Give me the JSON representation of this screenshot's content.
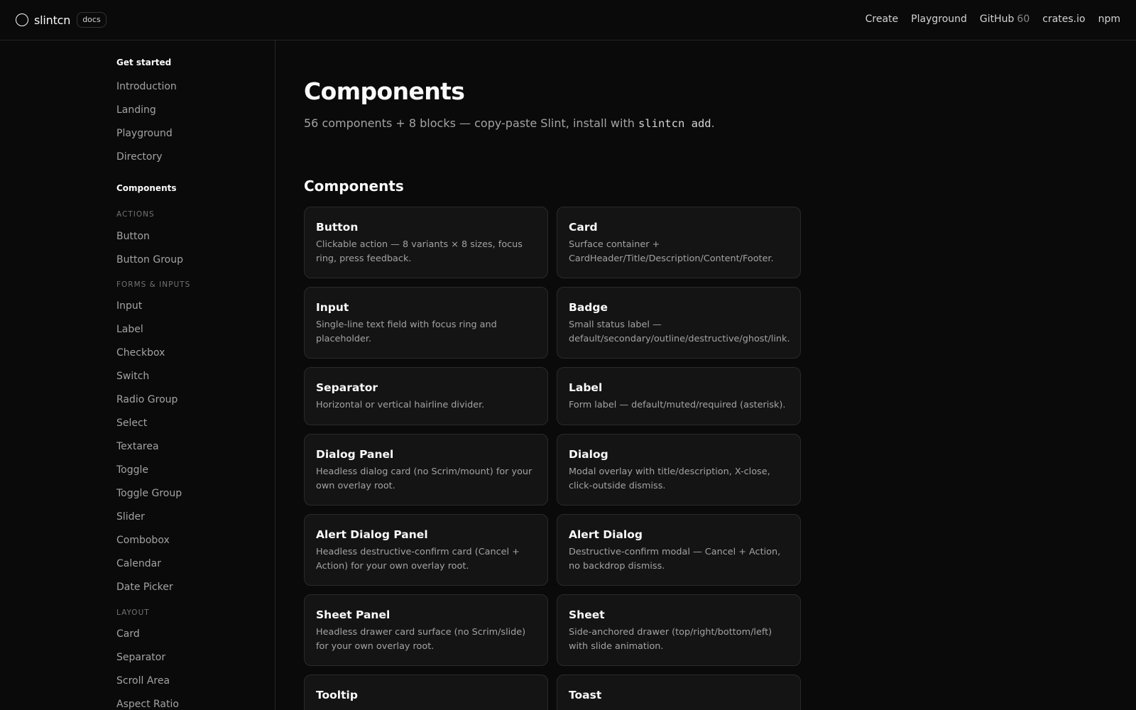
{
  "header": {
    "brand": "slintcn",
    "badge": "docs",
    "nav": {
      "create": "Create",
      "playground": "Playground",
      "github": "GitHub",
      "github_count": "60",
      "crates": "crates.io",
      "npm": "npm"
    }
  },
  "sidebar": {
    "get_started": "Get started",
    "get_started_items": [
      "Introduction",
      "Landing",
      "Playground",
      "Directory"
    ],
    "components": "Components",
    "cat_actions": "ACTIONS",
    "actions_items": [
      "Button",
      "Button Group"
    ],
    "cat_forms": "FORMS & INPUTS",
    "forms_items": [
      "Input",
      "Label",
      "Checkbox",
      "Switch",
      "Radio Group",
      "Select",
      "Textarea",
      "Toggle",
      "Toggle Group",
      "Slider",
      "Combobox",
      "Calendar",
      "Date Picker"
    ],
    "cat_layout": "LAYOUT",
    "layout_items": [
      "Card",
      "Separator",
      "Scroll Area",
      "Aspect Ratio"
    ]
  },
  "main": {
    "title": "Components",
    "subtitle_prefix": "56 components + 8 blocks — copy-paste Slint, install with ",
    "subtitle_code": "slintcn add",
    "subtitle_suffix": ".",
    "section_title": "Components",
    "cards": [
      {
        "title": "Button",
        "desc": "Clickable action — 8 variants × 8 sizes, focus ring, press feedback."
      },
      {
        "title": "Card",
        "desc": "Surface container + CardHeader/Title/Description/Content/Footer."
      },
      {
        "title": "Input",
        "desc": "Single-line text field with focus ring and placeholder."
      },
      {
        "title": "Badge",
        "desc": "Small status label — default/secondary/outline/destructive/ghost/link."
      },
      {
        "title": "Separator",
        "desc": "Horizontal or vertical hairline divider."
      },
      {
        "title": "Label",
        "desc": "Form label — default/muted/required (asterisk)."
      },
      {
        "title": "Dialog Panel",
        "desc": "Headless dialog card (no Scrim/mount) for your own overlay root."
      },
      {
        "title": "Dialog",
        "desc": "Modal overlay with title/description, X-close, click-outside dismiss."
      },
      {
        "title": "Alert Dialog Panel",
        "desc": "Headless destructive-confirm card (Cancel + Action) for your own overlay root."
      },
      {
        "title": "Alert Dialog",
        "desc": "Destructive-confirm modal — Cancel + Action, no backdrop dismiss."
      },
      {
        "title": "Sheet Panel",
        "desc": "Headless drawer card surface (no Scrim/slide) for your own overlay root."
      },
      {
        "title": "Sheet",
        "desc": "Side-anchored drawer (top/right/bottom/left) with slide animation."
      },
      {
        "title": "Tooltip",
        "desc": ""
      },
      {
        "title": "Toast",
        "desc": ""
      }
    ]
  }
}
